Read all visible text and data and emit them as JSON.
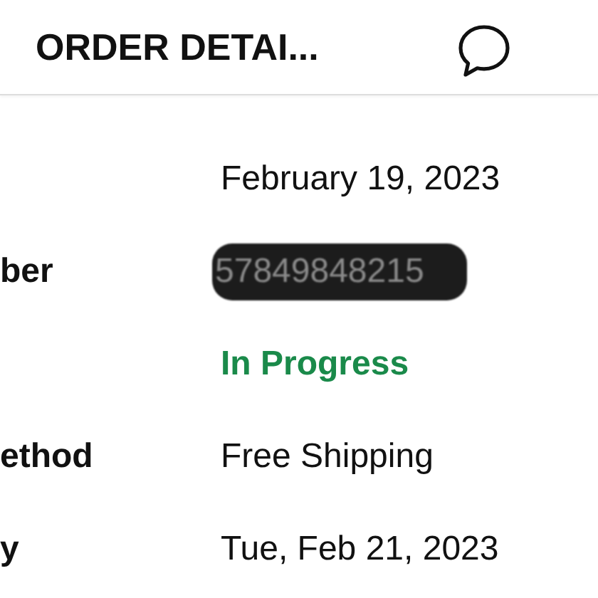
{
  "header": {
    "title": "ORDER DETAI..."
  },
  "rows": [
    {
      "label": "",
      "value": "February 19, 2023",
      "kind": "plain"
    },
    {
      "label": "ber",
      "value": "57849848215",
      "kind": "redacted"
    },
    {
      "label": "",
      "value": "In Progress",
      "kind": "status"
    },
    {
      "label": "ethod",
      "value": "Free Shipping",
      "kind": "plain"
    },
    {
      "label": "y",
      "value": "Tue, Feb 21, 2023",
      "kind": "plain"
    }
  ]
}
